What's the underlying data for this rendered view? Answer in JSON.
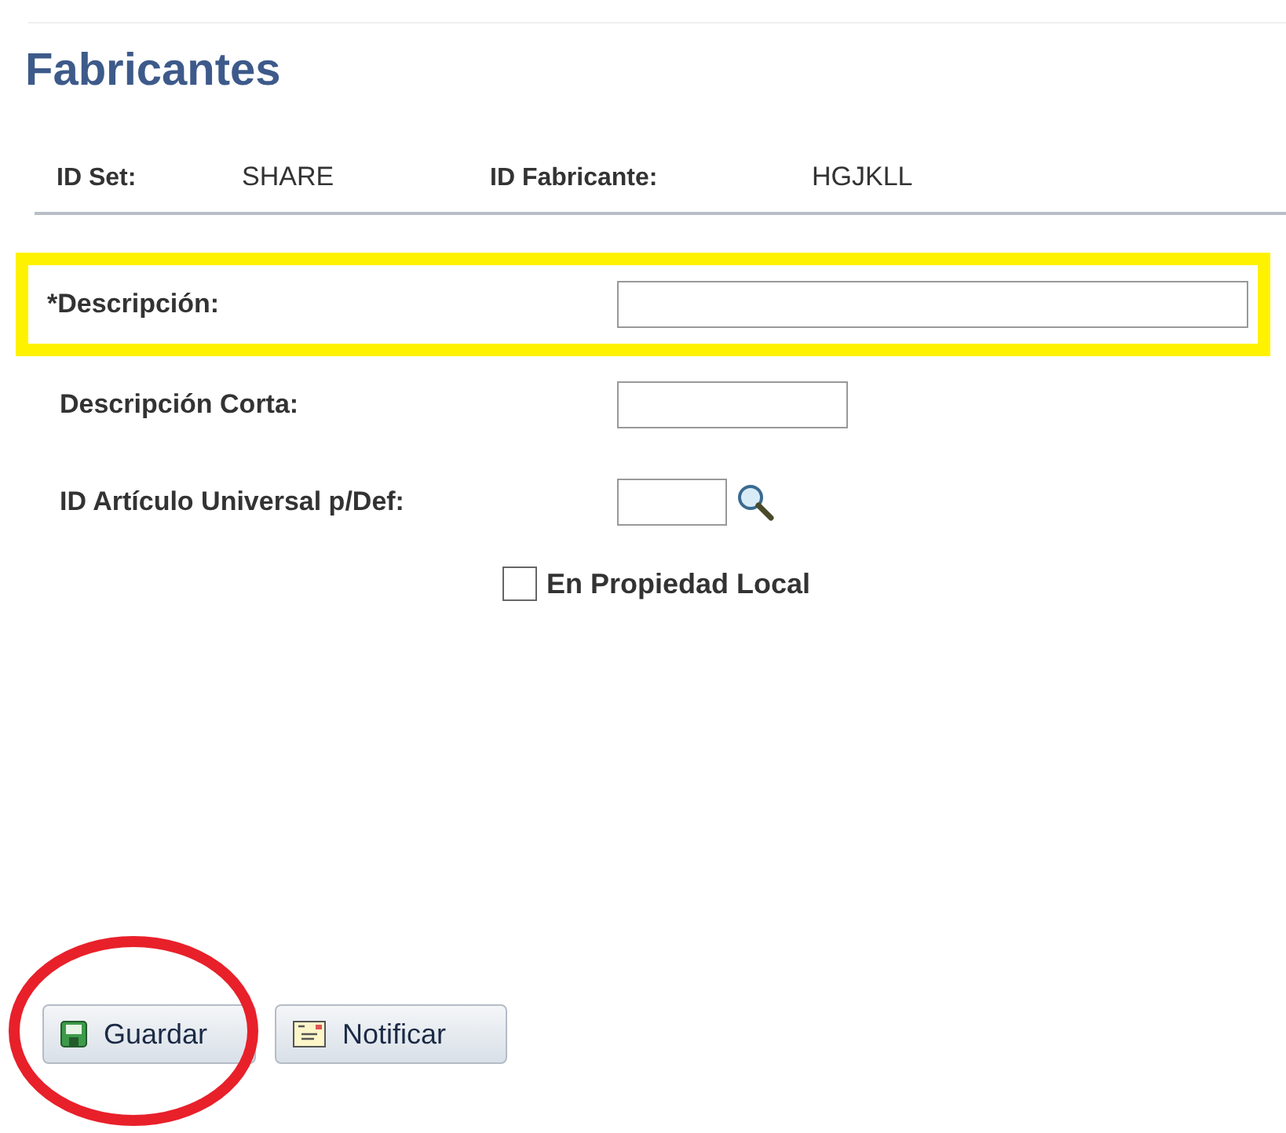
{
  "page": {
    "title": "Fabricantes"
  },
  "keys": [
    {
      "label": "ID Set:",
      "value": "SHARE"
    },
    {
      "label": "ID Fabricante:",
      "value": "HGJKLL"
    }
  ],
  "fields": [
    {
      "label": "*Descripción:",
      "kind": "long",
      "highlighted": true,
      "lookup": false
    },
    {
      "label": "Descripción Corta:",
      "kind": "medium",
      "highlighted": false,
      "lookup": false
    },
    {
      "label": "ID Artículo Universal p/Def:",
      "kind": "short",
      "highlighted": false,
      "lookup": true
    }
  ],
  "checkbox": {
    "label": "En Propiedad Local",
    "checked": false
  },
  "buttons": [
    {
      "label": "Guardar",
      "kind": "save",
      "circled": true
    },
    {
      "label": "Notificar",
      "kind": "notify",
      "circled": false
    }
  ]
}
